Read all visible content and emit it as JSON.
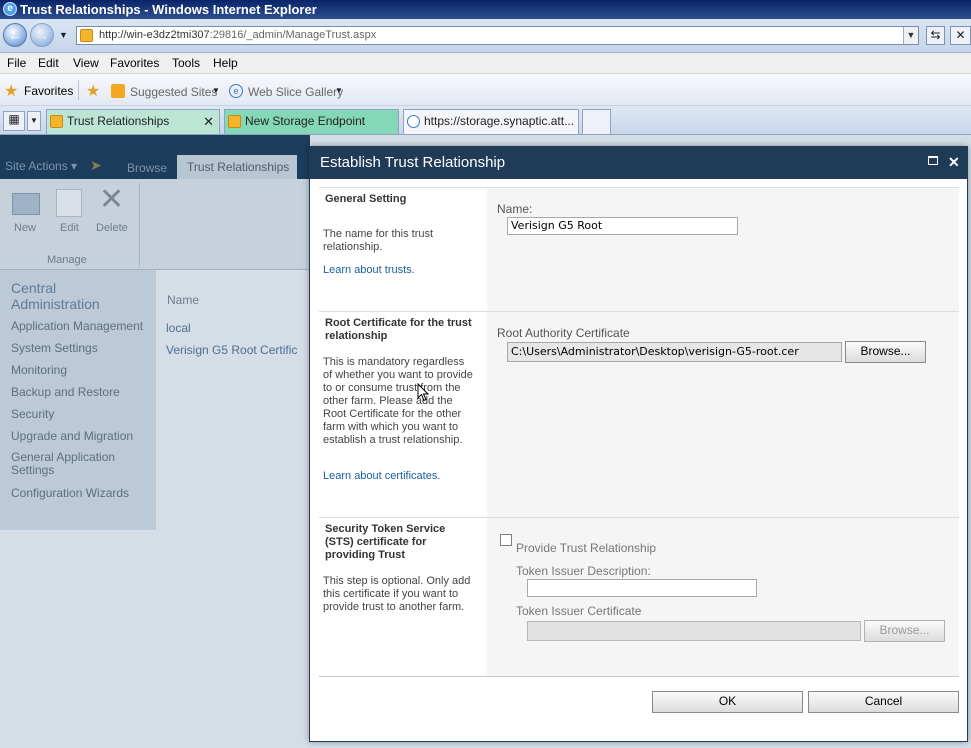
{
  "window": {
    "title": "Trust Relationships - Windows Internet Explorer"
  },
  "address_bar": {
    "url_prefix": "http://win-e3dz2tmi307",
    "url_rest": ":29816/_admin/ManageTrust.aspx"
  },
  "menu": [
    "File",
    "Edit",
    "View",
    "Favorites",
    "Tools",
    "Help"
  ],
  "favorites_bar": {
    "favorites_label": "Favorites",
    "suggested_sites": "Suggested Sites",
    "web_slice_gallery": "Web Slice Gallery"
  },
  "tabs": [
    {
      "label": "Trust Relationships",
      "active": true
    },
    {
      "label": "New Storage Endpoint"
    },
    {
      "label": "https://storage.synaptic.att..."
    }
  ],
  "ribbon": {
    "site_actions": "Site Actions",
    "browse": "Browse",
    "active_tab": "Trust Relationships",
    "new": "New",
    "edit": "Edit",
    "delete": "Delete",
    "group": "Manage"
  },
  "leftnav": {
    "title": "Central Administration",
    "items": [
      "Application Management",
      "System Settings",
      "Monitoring",
      "Backup and Restore",
      "Security",
      "Upgrade and Migration",
      "General Application Settings",
      "Configuration Wizards"
    ]
  },
  "list": {
    "header": "Name",
    "rows": [
      "local",
      "Verisign G5 Root Certific"
    ]
  },
  "dialog": {
    "title": "Establish Trust Relationship",
    "general": {
      "title": "General Setting",
      "desc": "The name for this trust relationship.",
      "link": "Learn about trusts.",
      "name_label": "Name:",
      "name_value": "Verisign G5 Root"
    },
    "root_cert": {
      "title": "Root Certificate for the trust relationship",
      "desc": "This is mandatory regardless of whether you want to provide to or consume trust from the other farm. Please add the Root Certificate for the other farm with which you want to establish a trust relationship.",
      "link": "Learn about certificates.",
      "field_label": "Root Authority Certificate",
      "field_value": "C:\\Users\\Administrator\\Desktop\\verisign-G5-root.cer",
      "browse": "Browse..."
    },
    "sts": {
      "title": "Security Token Service (STS) certificate for providing Trust",
      "desc": "This step is optional. Only add this certificate if you want to provide trust to another farm.",
      "checkbox_label": "Provide Trust Relationship",
      "issuer_desc_label": "Token Issuer Description:",
      "issuer_cert_label": "Token Issuer Certificate",
      "browse": "Browse..."
    },
    "ok": "OK",
    "cancel": "Cancel"
  }
}
